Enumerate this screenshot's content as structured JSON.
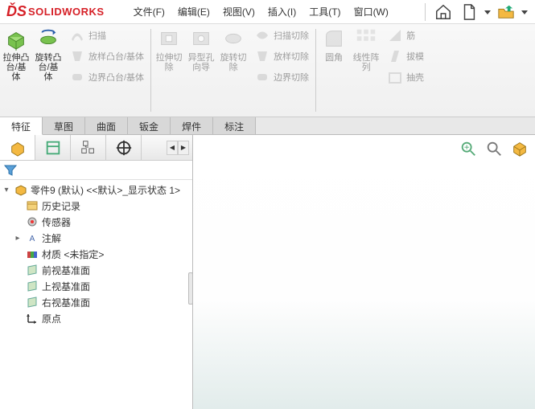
{
  "app": {
    "logo_text": "SOLIDWORKS"
  },
  "menu": [
    "文件(F)",
    "编辑(E)",
    "视图(V)",
    "插入(I)",
    "工具(T)",
    "窗口(W)"
  ],
  "ribbon": {
    "extrude": "拉伸凸台/基体",
    "revolve": "旋转凸台/基体",
    "sweep": "扫描",
    "loft": "放样凸台/基体",
    "boundary": "边界凸台/基体",
    "extrudeCut": "拉伸切除",
    "hole": "异型孔向导",
    "revolveCut": "旋转切除",
    "sweptCut": "扫描切除",
    "loftCut": "放样切除",
    "boundaryCut": "边界切除",
    "fillet": "圆角",
    "linPattern": "线性阵列",
    "rib": "筋",
    "draft": "拔模",
    "shell": "抽壳"
  },
  "doc_tabs": [
    "特征",
    "草图",
    "曲面",
    "钣金",
    "焊件",
    "标注"
  ],
  "tree": {
    "root": "零件9 (默认) <<默认>_显示状态 1>",
    "items": [
      {
        "label": "历史记录",
        "icon": "history"
      },
      {
        "label": "传感器",
        "icon": "sensor"
      },
      {
        "label": "注解",
        "icon": "annotation",
        "expandable": true
      },
      {
        "label": "材质 <未指定>",
        "icon": "material"
      },
      {
        "label": "前视基准面",
        "icon": "plane"
      },
      {
        "label": "上视基准面",
        "icon": "plane"
      },
      {
        "label": "右视基准面",
        "icon": "plane"
      },
      {
        "label": "原点",
        "icon": "origin"
      }
    ]
  }
}
